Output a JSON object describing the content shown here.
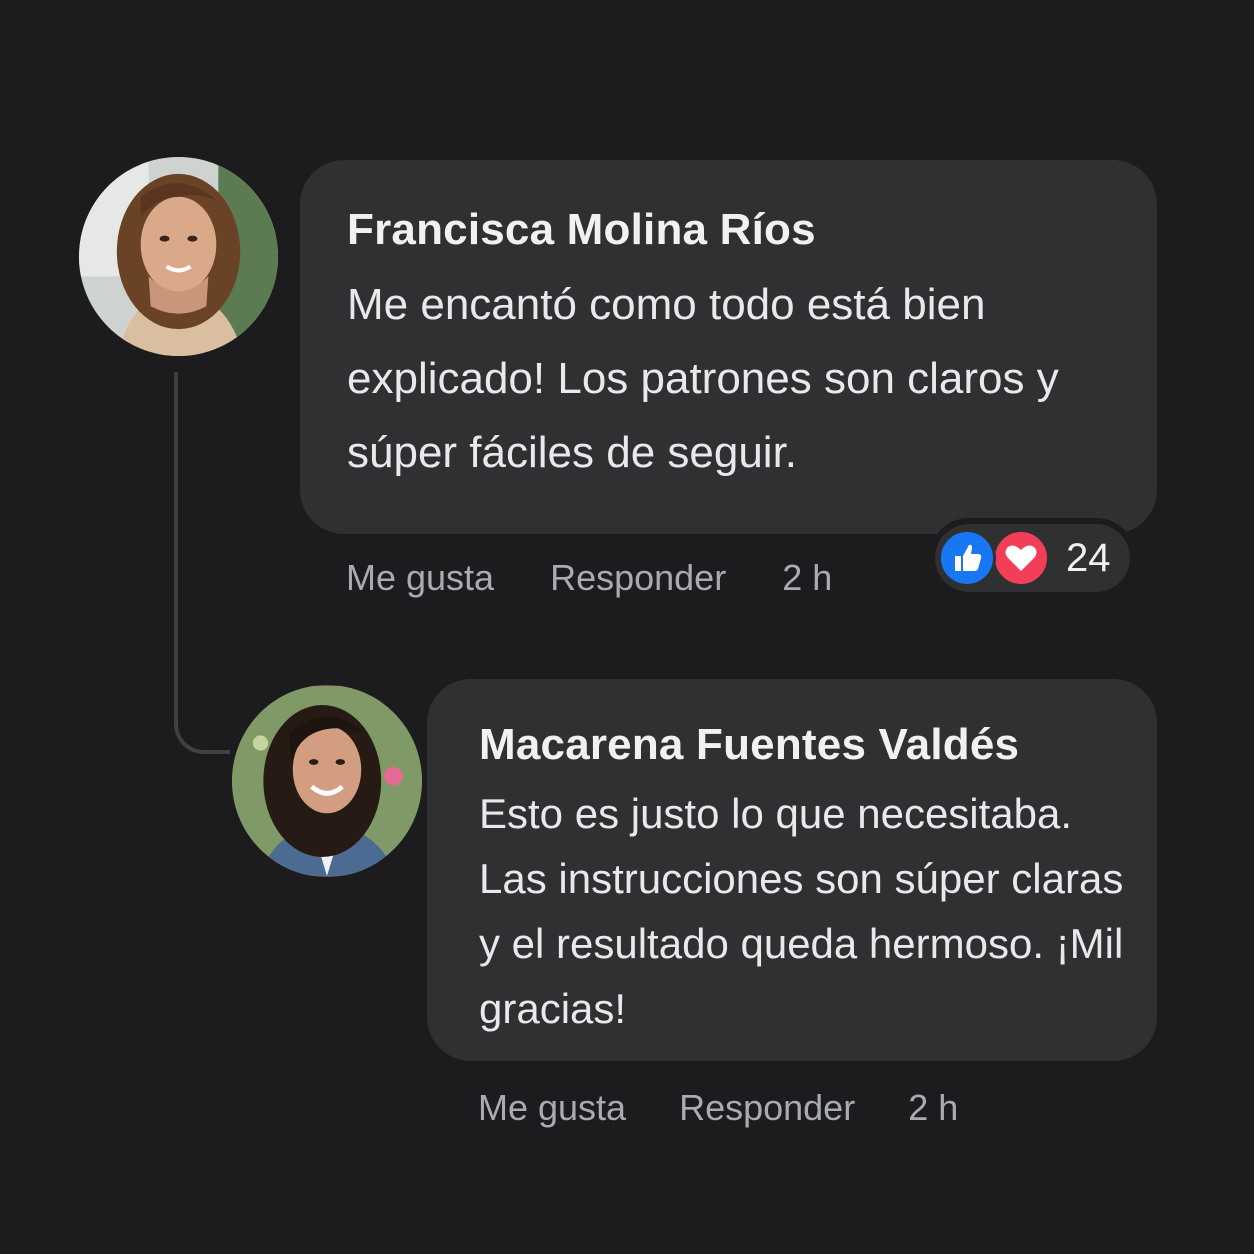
{
  "comments": [
    {
      "author": "Francisca Molina Ríos",
      "text": "Me encantó como todo está bien explicado! Los patrones son claros y súper fáciles de seguir.",
      "like_label": "Me gusta",
      "reply_label": "Responder",
      "time": "2 h",
      "reactions": {
        "icons": [
          "like-icon",
          "heart-icon"
        ],
        "count": "24"
      }
    },
    {
      "author": "Macarena Fuentes Valdés",
      "text": "Esto es justo lo que necesitaba. Las instrucciones son súper claras y el resultado queda hermoso. ¡Mil gracias!",
      "like_label": "Me gusta",
      "reply_label": "Responder",
      "time": "2 h"
    }
  ],
  "colors": {
    "background": "#1c1c1e",
    "bubble": "#2f3031",
    "like": "#1877f2",
    "love": "#f33e58"
  }
}
